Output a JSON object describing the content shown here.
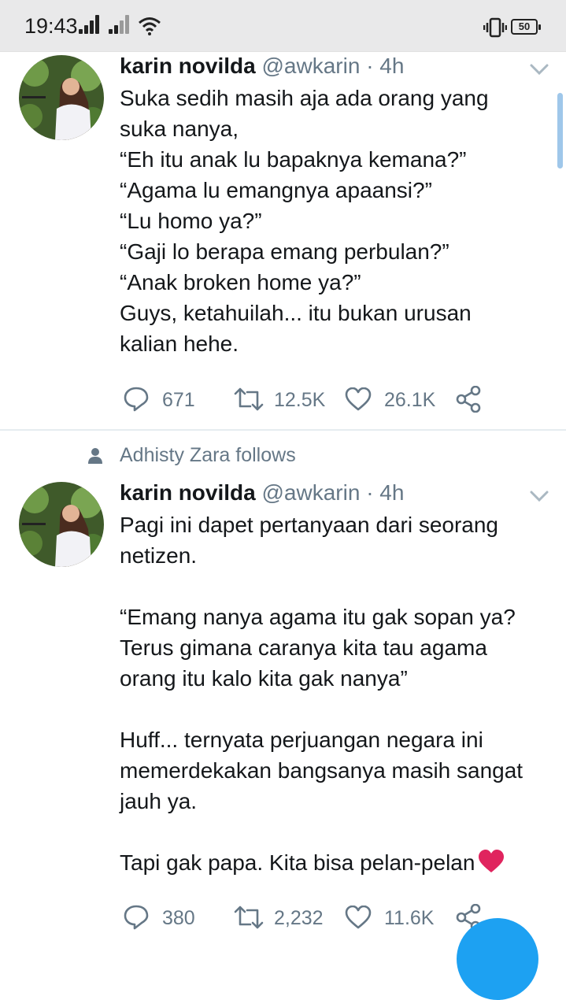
{
  "status_bar": {
    "time": "19:43",
    "battery": "50"
  },
  "social_context": {
    "text": "Adhisty Zara follows",
    "icon": "person-icon"
  },
  "tweets": [
    {
      "name": "karin novilda",
      "handle": "@awkarin",
      "separator": "·",
      "time": "4h",
      "lines": [
        "Suka sedih masih aja ada orang yang",
        "suka nanya,",
        "“Eh itu anak lu bapaknya kemana?”",
        "“Agama lu emangnya apaansi?”",
        "“Lu homo ya?”",
        "“Gaji lo berapa emang perbulan?”",
        "“Anak broken home ya?”",
        "Guys, ketahuilah... itu bukan urusan",
        "kalian hehe."
      ],
      "replies": "671",
      "retweets": "12.5K",
      "likes": "26.1K"
    },
    {
      "name": "karin novilda",
      "handle": "@awkarin",
      "separator": "·",
      "time": "4h",
      "lines": [
        "Pagi ini dapet pertanyaan dari seorang",
        "netizen.",
        "",
        "“Emang nanya agama itu gak sopan ya?",
        "Terus gimana caranya kita tau agama",
        "orang itu kalo kita gak nanya”",
        "",
        "Huff... ternyata perjuangan negara ini",
        "memerdekakan bangsanya masih sangat",
        "jauh ya.",
        "",
        "Tapi gak papa. Kita bisa pelan-pelan"
      ],
      "last_line_emoji": "red-heart-emoji",
      "replies": "380",
      "retweets": "2,232",
      "likes": "11.6K"
    }
  ],
  "colors": {
    "muted": "#657786",
    "accent": "#1da1f2",
    "heart": "#e0245e"
  }
}
